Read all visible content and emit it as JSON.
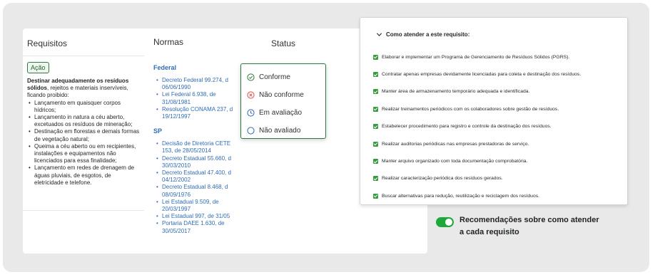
{
  "table": {
    "headers": {
      "requisitos": "Requisitos",
      "normas": "Normas",
      "status": "Status"
    },
    "badge": "Ação",
    "requirement": {
      "bold": "Destinar adequadamente os resíduos sólidos",
      "rest": ", rejeitos e materiais inservíveis, ficando proibido:",
      "items": [
        "Lançamento em quaisquer corpos hídricos;",
        "Lançamento in natura a céu aberto, excetuados os resíduos de mineração;",
        "Destinação em florestas e demais formas de vegetação natural;",
        "Queima a céu aberto ou em recipientes, instalações e equipamentos não licenciados para essa finalidade;",
        "Lançamento em redes de drenagem de águas pluviais, de esgotos, de eletricidade e telefone."
      ]
    },
    "norms": {
      "federal_title": "Federal",
      "federal": [
        "Decreto Federal 99.274, d",
        "06/06/1990",
        "Lei Federal 6.938, de",
        "31/08/1981",
        "Resolução CONAMA 237, d",
        "19/12/1997"
      ],
      "sp_title": "SP",
      "sp": [
        "Decisão de Diretoria CETE",
        "153, de 28/05/2014",
        "Decreto Estadual 55.660, d",
        "30/03/2010",
        "Decreto Estadual 47.400, d",
        "04/12/2002",
        "Decreto Estadual 8.468, d",
        "08/09/1976",
        "Lei Estadual 9.509, de",
        "20/03/1997",
        "Lei Estadual 997, de 31/05",
        "Portaria DAEE 1.630, de",
        "30/05/2017"
      ]
    },
    "status_options": [
      {
        "label": "Conforme",
        "icon": "check-circle-icon",
        "color": "#2e7a3a"
      },
      {
        "label": "Não conforme",
        "icon": "x-circle-icon",
        "color": "#d9534f"
      },
      {
        "label": "Em avaliação",
        "icon": "clock-icon",
        "color": "#2f6db3"
      },
      {
        "label": "Não avaliado",
        "icon": "empty-circle-icon",
        "color": "#2f6db3"
      }
    ]
  },
  "recommendations": {
    "title": "Como atender a este requisito:",
    "items": [
      "Elaborar e implementar um Programa de Gerenciamento de Resíduos Sólidos (PGRS).",
      "Contratar apenas empresas devidamente licenciadas para coleta e destinação dos resíduos.",
      "Manter área de armazenamento temporário adequada e identificada.",
      "Realizar treinamentos periódicos com os colaboradores sobre gestão de resíduos.",
      "Estabelecer procedimento para registro e controle da destinação dos resíduos.",
      "Realizar auditorias periódicas nas empresas prestadoras de serviço.",
      "Manter arquivo organizado com toda documentação comprobatória.",
      "Realizar caracterização periódica dos resíduos gerados.",
      "Buscar alternativas para redução, reutilização e reciclagem dos resíduos."
    ]
  },
  "toggle": {
    "on": true,
    "line1": "Recomendações sobre como atender",
    "line2": "a cada requisito"
  },
  "colors": {
    "accent_green": "#1fa83a",
    "link_blue": "#2f6db3"
  }
}
